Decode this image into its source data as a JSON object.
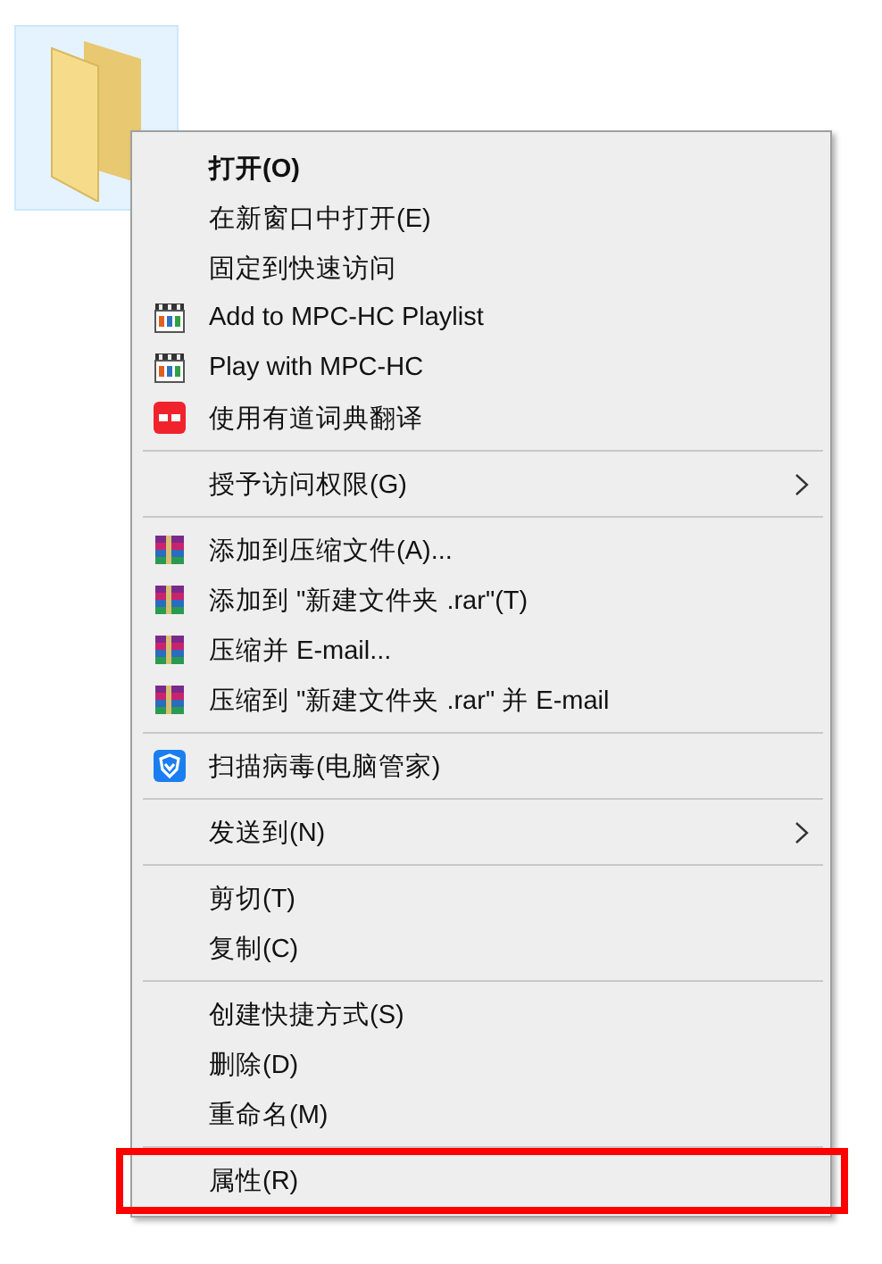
{
  "desktop_item": {
    "selected": true
  },
  "menu": [
    {
      "kind": "default",
      "label": "打开(O)",
      "submenu": false,
      "annotated": false
    },
    {
      "kind": "plain",
      "label": "在新窗口中打开(E)",
      "submenu": false,
      "annotated": false
    },
    {
      "kind": "plain",
      "label": "固定到快速访问",
      "submenu": false,
      "annotated": false
    },
    {
      "kind": "player",
      "label": "Add to MPC-HC Playlist",
      "submenu": false,
      "annotated": false
    },
    {
      "kind": "player",
      "label": "Play with MPC-HC",
      "submenu": false,
      "annotated": false
    },
    {
      "kind": "dictionary",
      "label": "使用有道词典翻译",
      "submenu": false,
      "annotated": false
    },
    {
      "kind": "separator"
    },
    {
      "kind": "plain",
      "label": "授予访问权限(G)",
      "submenu": true,
      "annotated": false
    },
    {
      "kind": "separator"
    },
    {
      "kind": "archive",
      "label": "添加到压缩文件(A)...",
      "submenu": false,
      "annotated": false
    },
    {
      "kind": "archive",
      "label": "添加到 \"新建文件夹 .rar\"(T)",
      "submenu": false,
      "annotated": false
    },
    {
      "kind": "archive",
      "label": "压缩并 E-mail...",
      "submenu": false,
      "annotated": false
    },
    {
      "kind": "archive",
      "label": "压缩到 \"新建文件夹 .rar\" 并 E-mail",
      "submenu": false,
      "annotated": false
    },
    {
      "kind": "separator"
    },
    {
      "kind": "shield",
      "label": "扫描病毒(电脑管家)",
      "submenu": false,
      "annotated": false
    },
    {
      "kind": "separator"
    },
    {
      "kind": "plain",
      "label": "发送到(N)",
      "submenu": true,
      "annotated": false
    },
    {
      "kind": "separator"
    },
    {
      "kind": "plain",
      "label": "剪切(T)",
      "submenu": false,
      "annotated": false
    },
    {
      "kind": "plain",
      "label": "复制(C)",
      "submenu": false,
      "annotated": false
    },
    {
      "kind": "separator"
    },
    {
      "kind": "plain",
      "label": "创建快捷方式(S)",
      "submenu": false,
      "annotated": false
    },
    {
      "kind": "plain",
      "label": "删除(D)",
      "submenu": false,
      "annotated": false
    },
    {
      "kind": "plain",
      "label": "重命名(M)",
      "submenu": false,
      "annotated": false
    },
    {
      "kind": "separator"
    },
    {
      "kind": "plain",
      "label": "属性(R)",
      "submenu": false,
      "annotated": true
    }
  ]
}
